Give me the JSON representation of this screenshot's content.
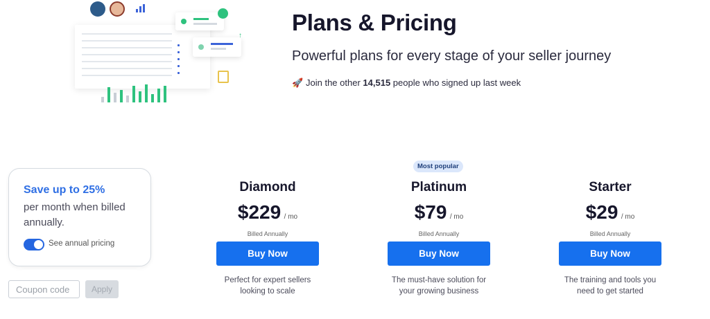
{
  "header": {
    "title": "Plans & Pricing",
    "subtitle": "Powerful plans for every stage of your seller journey",
    "social_proof_prefix": "Join the other",
    "social_proof_count": "14,515",
    "social_proof_suffix": "people who signed up last week"
  },
  "annual": {
    "headline": "Save up to 25%",
    "text": "per month when billed annually.",
    "toggle_label": "See annual pricing",
    "toggle_on": true
  },
  "coupon": {
    "placeholder": "Coupon code",
    "apply_label": "Apply"
  },
  "plans": [
    {
      "badge": "",
      "name": "Diamond",
      "price": "$229",
      "period": "/ mo",
      "billing": "Billed Annually",
      "cta": "Buy Now",
      "description": "Perfect for expert sellers looking to scale"
    },
    {
      "badge": "Most popular",
      "name": "Platinum",
      "price": "$79",
      "period": "/ mo",
      "billing": "Billed Annually",
      "cta": "Buy Now",
      "description": "The must-have solution for your growing business"
    },
    {
      "badge": "",
      "name": "Starter",
      "price": "$29",
      "period": "/ mo",
      "billing": "Billed Annually",
      "cta": "Buy Now",
      "description": "The training and tools you need to get started"
    }
  ],
  "colors": {
    "accent": "#1670ee",
    "save_text": "#2f6fe4",
    "badge_bg": "#dbe7fb",
    "chart_green": "#2ec27e"
  }
}
